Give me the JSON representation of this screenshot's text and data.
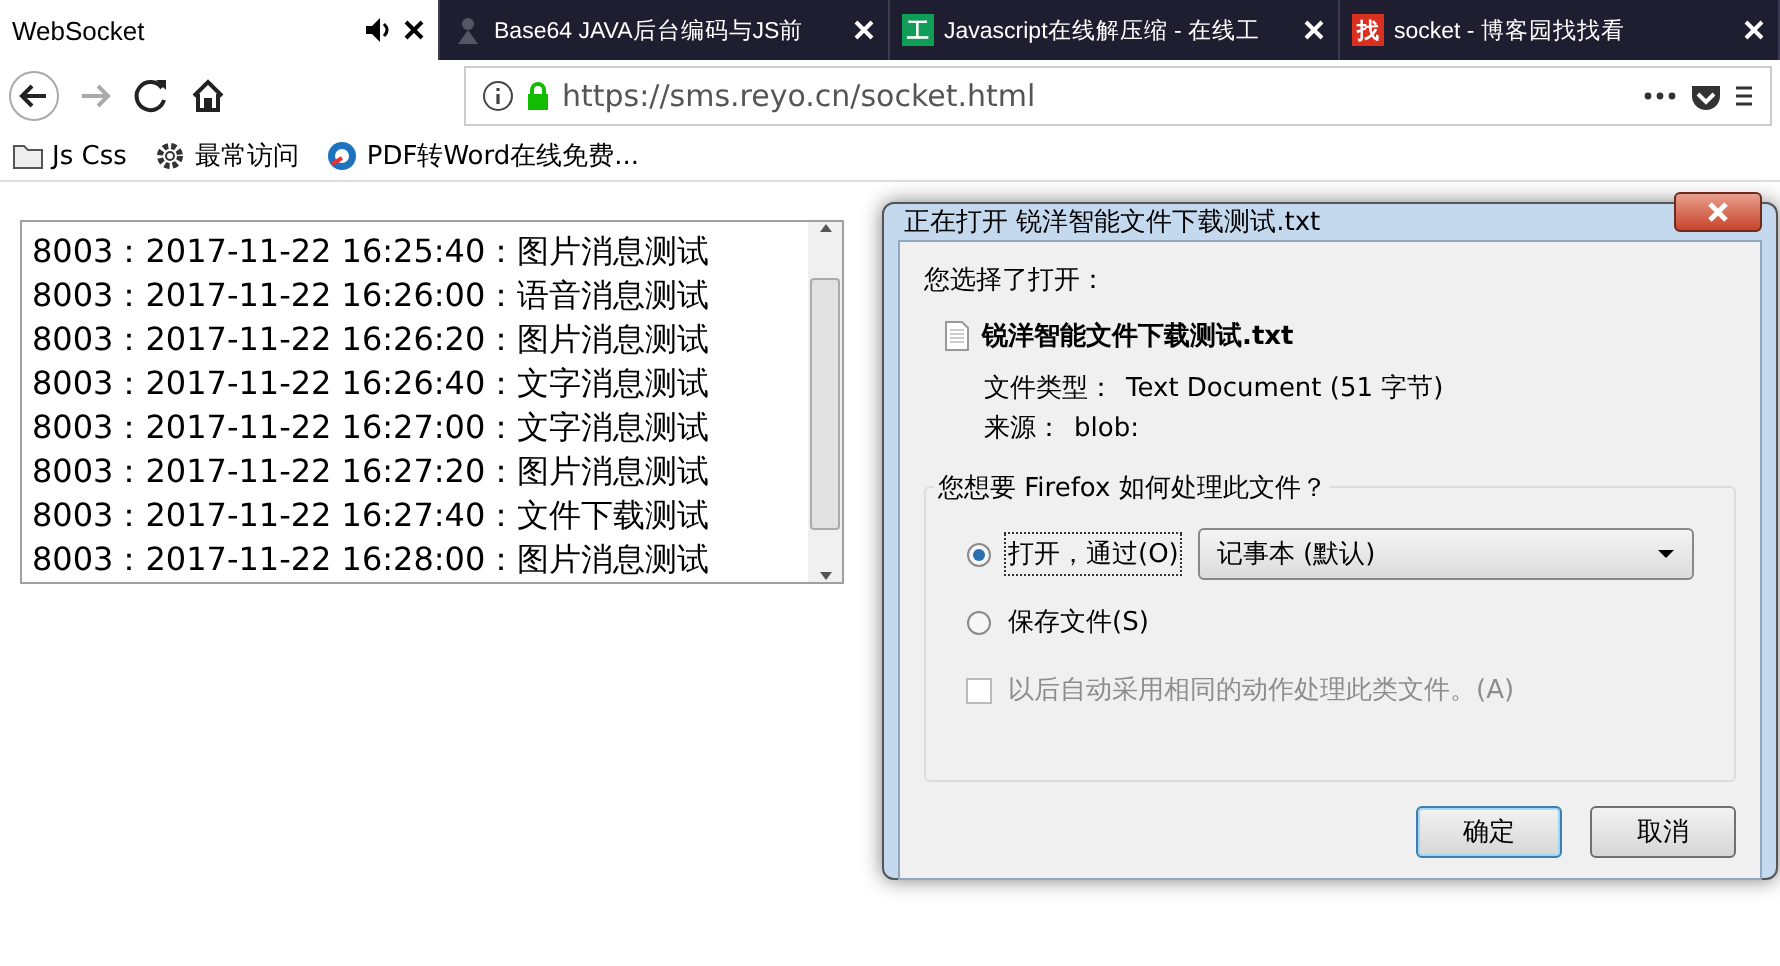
{
  "browser": {
    "tabs": [
      {
        "title": "WebSocket",
        "selected": true,
        "audio": true
      },
      {
        "title": "Base64 JAVA后台编码与JS前",
        "selected": false
      },
      {
        "title": "Javascript在线解压缩 - 在线工",
        "selected": false,
        "badge": {
          "text": "工",
          "color": "#0f9d58"
        }
      },
      {
        "title": "socket - 博客园找找看",
        "selected": false,
        "badge": {
          "text": "找",
          "color": "#d9301f"
        }
      }
    ],
    "url": "https://sms.reyo.cn/socket.html",
    "bookmarks": [
      {
        "label": "Js Css",
        "kind": "folder"
      },
      {
        "label": "最常访问",
        "kind": "gear"
      },
      {
        "label": "PDF转Word在线免费...",
        "kind": "site"
      }
    ]
  },
  "log": {
    "lines": [
      "8003：2017-11-22 16:25:40：图片消息测试",
      "8003：2017-11-22 16:26:00：语音消息测试",
      "8003：2017-11-22 16:26:20：图片消息测试",
      "8003：2017-11-22 16:26:40：文字消息测试",
      "8003：2017-11-22 16:27:00：文字消息测试",
      "8003：2017-11-22 16:27:20：图片消息测试",
      "8003：2017-11-22 16:27:40：文件下载测试",
      "8003：2017-11-22 16:28:00：图片消息测试"
    ]
  },
  "dialog": {
    "title": "正在打开 锐洋智能文件下载测试.txt",
    "intro": "您选择了打开：",
    "filename": "锐洋智能文件下载测试.txt",
    "details": [
      {
        "label": "文件类型：",
        "value": "Text Document (51 字节)"
      },
      {
        "label": "来源：",
        "value": "blob:"
      }
    ],
    "group_title": "您想要 Firefox 如何处理此文件？",
    "options": [
      {
        "kind": "radio",
        "label": "打开，通过(O)",
        "selected": true,
        "app": "记事本 (默认)"
      },
      {
        "kind": "radio",
        "label": "保存文件(S)",
        "selected": false
      },
      {
        "kind": "checkbox",
        "label": "以后自动采用相同的动作处理此类文件。(A)",
        "checked": false,
        "disabled": true
      }
    ],
    "buttons": [
      {
        "label": "确定",
        "default": true
      },
      {
        "label": "取消",
        "default": false
      }
    ]
  }
}
